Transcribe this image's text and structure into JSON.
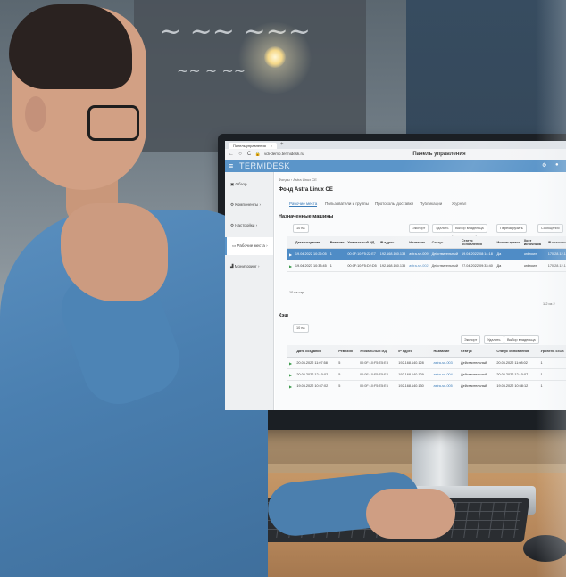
{
  "browser": {
    "tab_title": "Панель управления",
    "new_tab": "+",
    "url": "vdi-demo.termidesk.ru",
    "page_title": "Панель управления",
    "back": "←",
    "reload": "C"
  },
  "app": {
    "brand": "TERMIDESK",
    "accent_color": "#5b95c9",
    "sidebar": [
      {
        "label": "Обзор"
      },
      {
        "label": "Компоненты"
      },
      {
        "label": "Настройки"
      },
      {
        "label": "Рабочие места"
      },
      {
        "label": "Мониторинг"
      }
    ]
  },
  "main": {
    "breadcrumb": "Фонды  ›  Astra Linux CE",
    "title": "Фонд Astra Linux CE",
    "tabs": [
      {
        "label": "Рабочие места"
      },
      {
        "label": "Пользователи и группы"
      },
      {
        "label": "Протоколы доставки"
      },
      {
        "label": "Публикации"
      },
      {
        "label": "Журнал"
      }
    ],
    "section1": "Назначенные машины",
    "section2": "Кэш",
    "toolbar": {
      "per_page": "10 на",
      "export": "Экспорт",
      "delete": "Удалить",
      "change_owner": "Выбор владельца",
      "refresh": "Перезагрузить",
      "messages": "Сообщения",
      "execute": "Выполнить"
    },
    "assigned_table": {
      "columns": [
        "Дата создания",
        "Ревизия",
        "Уникальный ИД",
        "IP адрес",
        "Название",
        "Статус",
        "Статус обновления",
        "Используется",
        "Хост источника",
        "IP источника"
      ],
      "rows": [
        [
          "19.04.2022 10:26:05",
          "1",
          "00:0F:10:F5:22:E7",
          "192.168.140.133",
          "astra-se-009",
          "Действительный",
          "19.04.2022 08:14:18",
          "Да",
          "unknown",
          "170.28.12.146"
        ],
        [
          "19.04.2023 10:33:45",
          "1",
          "00:0F:10:F5:D2:D5",
          "192.168.140.135",
          "astra-se-002",
          "Действительный",
          "27.04.2022 09:33:40",
          "Да",
          "unknown",
          "170.28.12.146"
        ]
      ]
    },
    "pager1": "10 на стр.",
    "pager1_pages": "1-2 из 2",
    "cache_table": {
      "columns": [
        "Дата создания",
        "Ревизия",
        "Уникальный ИД",
        "IP адрес",
        "Название",
        "Статус",
        "Статус обновления",
        "Уровень кэша"
      ],
      "rows": [
        [
          "20.06.2022 11:07:58",
          "5",
          "00:0F:10:F5:E5:E3",
          "192.168.140.128",
          "astra-se-003",
          "Действительный",
          "20.06.2022 11:08:02",
          "1"
        ],
        [
          "20.06.2022 12:10:02",
          "5",
          "00:0F:10:F5:E5:E4",
          "192.168.140.129",
          "astra-se-004",
          "Действительный",
          "20.06.2022 12:10:07",
          "1"
        ],
        [
          "19.05.2022 10:57:02",
          "5",
          "00:0F:10:F5:E5:E6",
          "192.168.140.130",
          "astra-se-005",
          "Действительный",
          "19.05.2022 10:58:12",
          "1"
        ]
      ]
    }
  }
}
